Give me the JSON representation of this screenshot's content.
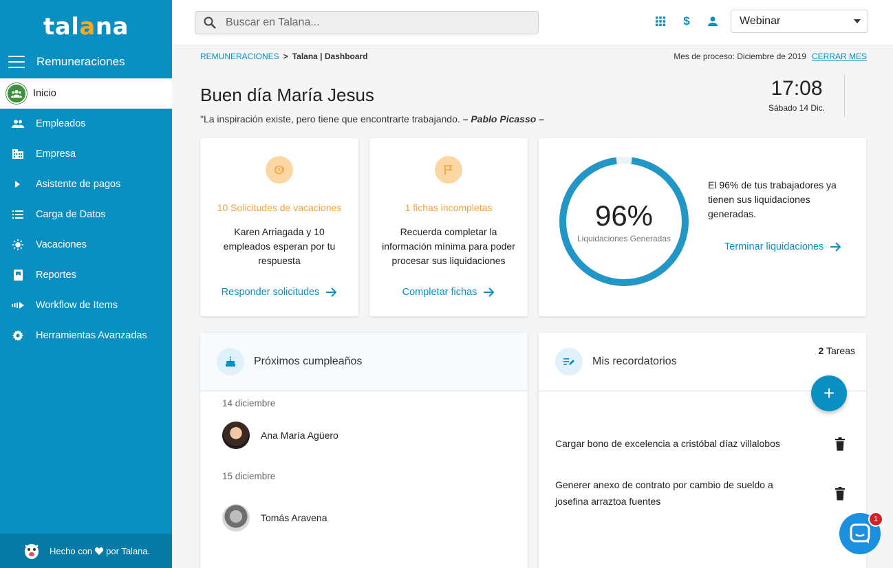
{
  "brand": {
    "logo_text": "talana",
    "accent": "#0a8fc2",
    "logo_accent": "#f7a825"
  },
  "sidebar": {
    "module": "Remuneraciones",
    "items": [
      {
        "label": "Inicio",
        "icon": "people-group-icon",
        "active": true
      },
      {
        "label": "Empleados",
        "icon": "people-icon"
      },
      {
        "label": "Empresa",
        "icon": "building-icon"
      },
      {
        "label": "Asistente de pagos",
        "icon": "play-arrow-icon"
      },
      {
        "label": "Carga de Datos",
        "icon": "list-icon"
      },
      {
        "label": "Vacaciones",
        "icon": "sun-icon"
      },
      {
        "label": "Reportes",
        "icon": "report-icon"
      },
      {
        "label": "Workflow de Items",
        "icon": "workflow-icon"
      },
      {
        "label": "Herramientas Avanzadas",
        "icon": "gear-icon"
      }
    ],
    "footer": {
      "prefix": "Hecho con",
      "suffix": "por Talana."
    }
  },
  "topbar": {
    "search_placeholder": "Buscar en Talana...",
    "company": "Webinar"
  },
  "breadcrumb": {
    "section": "REMUNERACIONES",
    "separator": ">",
    "current": "Talana | Dashboard"
  },
  "process": {
    "label": "Mes de proceso: Diciembre de 2019",
    "close_label": "CERRAR MES"
  },
  "greeting": {
    "title": "Buen día María Jesus",
    "quote": "\"La inspiración existe, pero tiene que encontrarte trabajando.",
    "author": "– Pablo Picasso –"
  },
  "clock": {
    "time": "17:08",
    "date": "Sábado 14 Dic."
  },
  "cards": {
    "vacations": {
      "title": "10 Solicitudes de vacaciones",
      "desc": "Karen Arriagada y 10 empleados esperan por tu respuesta",
      "action": "Responder solicitudes"
    },
    "files": {
      "title": "1 fichas incompletas",
      "desc": "Recuerda completar la información mínima para poder procesar sus liquidaciones",
      "action": "Completar fichas"
    },
    "payroll": {
      "percent_label": "96%",
      "percent_value": 0.96,
      "caption": "Liquidaciones Generadas",
      "message": "El 96% de tus trabajadores ya tienen sus liquidaciones generadas.",
      "action": "Terminar liquidaciones"
    }
  },
  "birthdays": {
    "title": "Próximos cumpleaños",
    "groups": [
      {
        "date": "14 diciembre",
        "name": "Ana María Agüero"
      },
      {
        "date": "15 diciembre",
        "name": "Tomás Aravena"
      }
    ]
  },
  "reminders": {
    "title": "Mis recordatorios",
    "count": "2",
    "count_label": "Tareas",
    "add_label": "+",
    "items": [
      "Cargar bono de excelencia a cristóbal díaz villalobos",
      "Generer anexo de contrato por cambio de sueldo a josefina arraztoa fuentes"
    ]
  },
  "chat": {
    "badge": "1"
  }
}
